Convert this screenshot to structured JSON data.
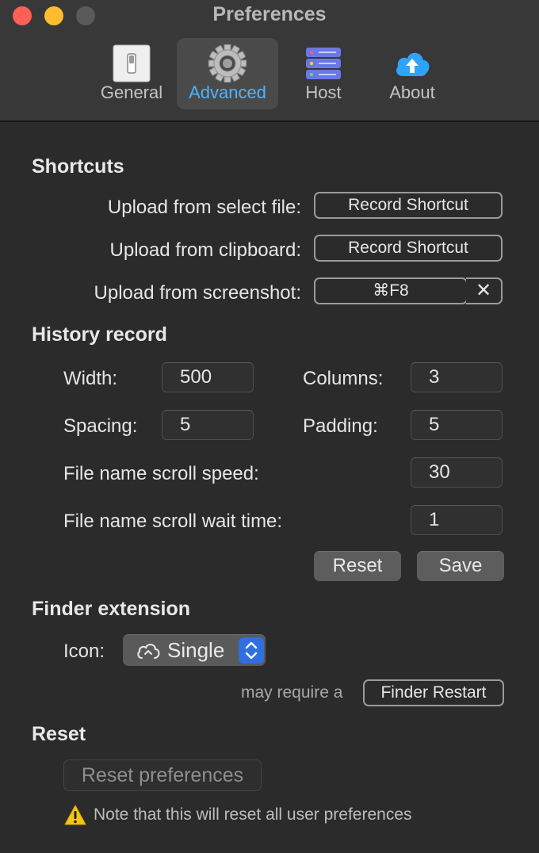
{
  "window": {
    "title": "Preferences"
  },
  "tabs": [
    {
      "label": "General",
      "icon": "toggle-switch-icon",
      "selected": false
    },
    {
      "label": "Advanced",
      "icon": "gear-icon",
      "selected": true
    },
    {
      "label": "Host",
      "icon": "server-icon",
      "selected": false
    },
    {
      "label": "About",
      "icon": "cloud-upload-icon",
      "selected": false
    }
  ],
  "shortcuts": {
    "title": "Shortcuts",
    "rows": [
      {
        "label": "Upload from select file:",
        "value": "Record Shortcut"
      },
      {
        "label": "Upload from clipboard:",
        "value": "Record Shortcut"
      },
      {
        "label": "Upload from screenshot:",
        "value": "⌘F8",
        "clear": "✕"
      }
    ]
  },
  "history": {
    "title": "History record",
    "width_label": "Width:",
    "width_value": "500",
    "columns_label": "Columns:",
    "columns_value": "3",
    "spacing_label": "Spacing:",
    "spacing_value": "5",
    "padding_label": "Padding:",
    "padding_value": "5",
    "scroll_speed_label": "File name scroll speed:",
    "scroll_speed_value": "30",
    "scroll_wait_label": "File name scroll wait time:",
    "scroll_wait_value": "1",
    "reset_label": "Reset",
    "save_label": "Save"
  },
  "finder": {
    "title": "Finder extension",
    "icon_label": "Icon:",
    "icon_value": "Single",
    "note": "may require a",
    "restart_label": "Finder Restart"
  },
  "reset": {
    "title": "Reset",
    "button_label": "Reset preferences",
    "warning": "Note that this will reset all user preferences"
  },
  "colors": {
    "accent": "#4fb3ff",
    "popup_arrows": "#2f6fe0",
    "close": "#ff5f57",
    "minimize": "#febc2e"
  }
}
